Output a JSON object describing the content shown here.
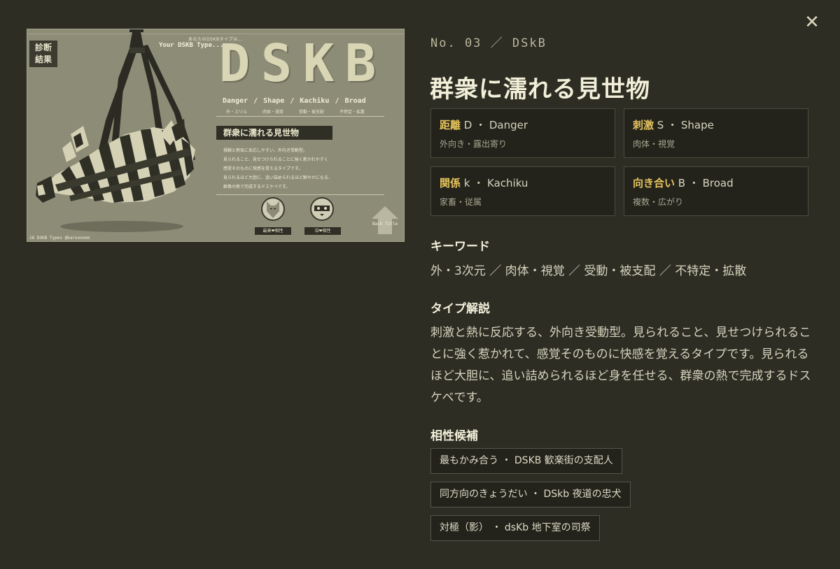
{
  "close": {
    "glyph": "✕"
  },
  "card": {
    "badge_line1": "診断",
    "badge_line2": "結果",
    "small_caption": "あなたのDSKBタイプは…",
    "your_type": "Your DSKB Type...",
    "big_letters": [
      "D",
      "S",
      "K",
      "B"
    ],
    "axis_words": [
      {
        "word": "Danger",
        "sub": "外・スリル"
      },
      {
        "word": "Shape",
        "sub": "肉体・視覚"
      },
      {
        "word": "Kachiku",
        "sub": "受動・被支配"
      },
      {
        "word": "Broad",
        "sub": "不特定・拡散"
      }
    ],
    "title": "群衆に濡れる見世物",
    "desc_lines": [
      "視線と熱気に反応しやすい、外向き受動型。",
      "見られること、見せつけられることに強く惹かれやすく",
      "感覚そのものに快感を覚えるタイプです。",
      "見られるほど大胆に、追い詰められるほど鮮やかになる、",
      "群衆の熱で完成するドスケベです。"
    ],
    "portrait1_label": "最高❤相性",
    "portrait2_label": "沼❤相性",
    "back_title": "Back Title",
    "footer": "16 DSKB Types @karoonoms"
  },
  "header": {
    "number": "No. 03 ／ DSkB",
    "title": "群衆に濡れる見世物"
  },
  "axes": [
    {
      "label": "距離",
      "value": "D ・ Danger",
      "sub": "外向き・露出寄り"
    },
    {
      "label": "刺激",
      "value": "S ・ Shape",
      "sub": "肉体・視覚"
    },
    {
      "label": "関係",
      "value": "k ・ Kachiku",
      "sub": "家畜・従属"
    },
    {
      "label": "向き合い",
      "value": "B ・ Broad",
      "sub": "複数・広がり"
    }
  ],
  "keywords": {
    "heading": "キーワード",
    "text": "外・3次元 ／ 肉体・視覚 ／ 受動・被支配 ／ 不特定・拡散"
  },
  "description": {
    "heading": "タイプ解説",
    "text": "刺激と熱に反応する、外向き受動型。見られること、見せつけられることに強く惹かれて、感覚そのものに快感を覚えるタイプです。見られるほど大胆に、追い詰められるほど身を任せる、群衆の熱で完成するドスケベです。"
  },
  "compatibility": {
    "heading": "相性候補",
    "items": [
      "最もかみ合う ・ DSKB 歓楽街の支配人",
      "同方向のきょうだい ・ DSkb 夜道の忠犬",
      "対極（影） ・ dsKb 地下室の司祭"
    ]
  },
  "colors": {
    "background": "#2d2d24",
    "accent": "#e6c45d",
    "card": "#8d8c77"
  }
}
